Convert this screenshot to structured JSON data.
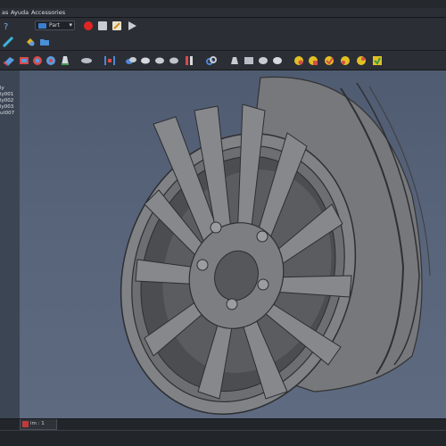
{
  "menu": {
    "items": [
      "as",
      "Ayuda",
      "Accessories"
    ]
  },
  "toolbar": {
    "part_selector": "Part",
    "part_selector_arrow": "▾",
    "record_macro": "record-macro-icon",
    "stop_macro": "stop-macro-icon",
    "edit_macro": "edit-macro-icon",
    "run_macro": "run-macro-icon"
  },
  "tree": {
    "items": [
      "ly",
      "ly001",
      "ly002",
      "ly003",
      "ut007"
    ]
  },
  "document_tab": {
    "label": "im : 1"
  },
  "colors": {
    "background": "#1e2125",
    "toolbar": "#2b2f35",
    "viewport_top": "#4f5b70",
    "viewport_bottom": "#5e6a80",
    "tree_panel": "#3c4553",
    "model_gray": "#7a7c80"
  }
}
